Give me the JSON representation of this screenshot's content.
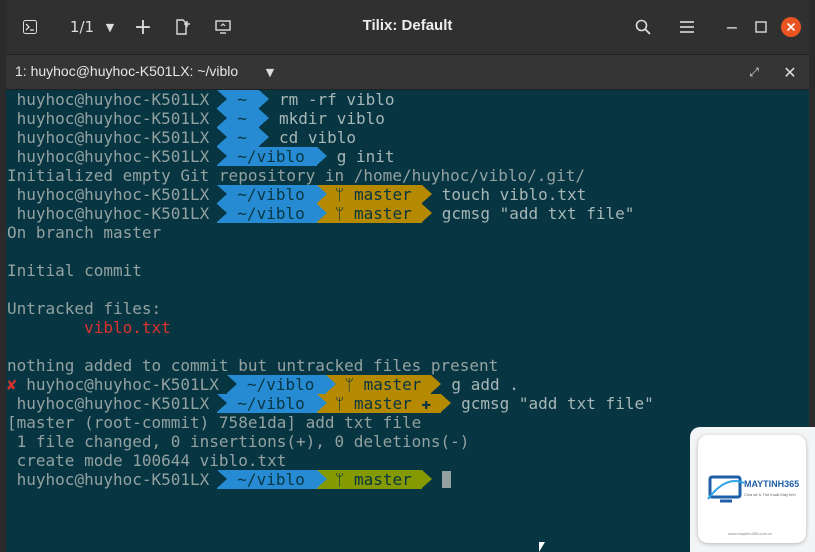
{
  "titlebar": {
    "title": "Tilix: Default",
    "session_counter": "1/1"
  },
  "tab": {
    "title": "1: huyhoc@huyhoc-K501LX: ~/viblo"
  },
  "colors": {
    "terminal_bg": "#073642",
    "dir_segment": "#268bd2",
    "git_dirty": "#b58900",
    "git_clean": "#859900",
    "error": "#dc322f"
  },
  "prompt": {
    "user_host": "huyhoc@huyhoc-K501LX",
    "err_mark": "✘",
    "branch_icon": "ᛘ",
    "dirty_mark": "✚"
  },
  "lines": [
    {
      "dir": "~",
      "cmd": "rm -rf viblo"
    },
    {
      "dir": "~",
      "cmd": "mkdir viblo"
    },
    {
      "dir": "~",
      "cmd": "cd viblo"
    },
    {
      "dir": "~/viblo",
      "cmd": "g init"
    },
    {
      "text": "Initialized empty Git repository in /home/huyhoc/viblo/.git/"
    },
    {
      "dir": "~/viblo",
      "branch": "master",
      "cmd": "touch viblo.txt"
    },
    {
      "dir": "~/viblo",
      "branch": "master",
      "cmd": "gcmsg \"add txt file\""
    },
    {
      "text": "On branch master"
    },
    {
      "text": ""
    },
    {
      "text": "Initial commit"
    },
    {
      "text": ""
    },
    {
      "text": "Untracked files:"
    },
    {
      "text": "        viblo.txt",
      "red": true
    },
    {
      "text": ""
    },
    {
      "text": "nothing added to commit but untracked files present"
    },
    {
      "dir": "~/viblo",
      "branch": "master",
      "cmd": "g add .",
      "error": true
    },
    {
      "dir": "~/viblo",
      "branch": "master",
      "cmd": "gcmsg \"add txt file\"",
      "dirty": true
    },
    {
      "text": "[master (root-commit) 758e1da] add txt file"
    },
    {
      "text": " 1 file changed, 0 insertions(+), 0 deletions(-)"
    },
    {
      "text": " create mode 100644 viblo.txt"
    },
    {
      "dir": "~/viblo",
      "branch": "master",
      "cmd": "",
      "clean": true,
      "cursor": true
    }
  ],
  "watermark": {
    "brand": "MAYTINH365",
    "tagline": "Chia sẻ & Thủ thuật Máy tính",
    "url": "www.maytinh365.com.vn"
  }
}
